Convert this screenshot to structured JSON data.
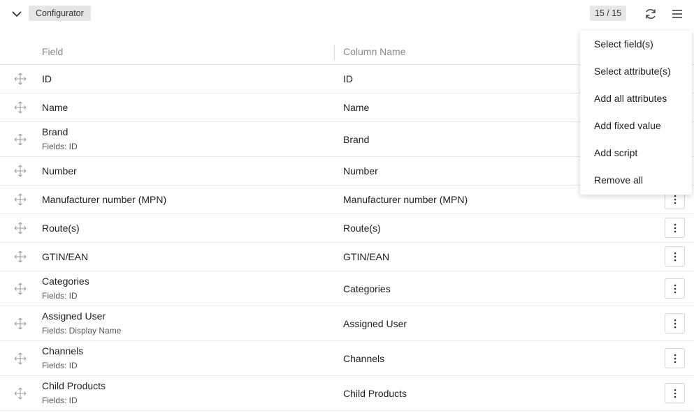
{
  "toolbar": {
    "configurator_label": "Configurator",
    "counter": "15 / 15"
  },
  "table": {
    "headers": {
      "field": "Field",
      "column_name": "Column Name"
    },
    "rows": [
      {
        "field": "ID",
        "sub": "",
        "column": "ID"
      },
      {
        "field": "Name",
        "sub": "",
        "column": "Name"
      },
      {
        "field": "Brand",
        "sub": "Fields: ID",
        "column": "Brand"
      },
      {
        "field": "Number",
        "sub": "",
        "column": "Number"
      },
      {
        "field": "Manufacturer number (MPN)",
        "sub": "",
        "column": "Manufacturer number (MPN)"
      },
      {
        "field": "Route(s)",
        "sub": "",
        "column": "Route(s)"
      },
      {
        "field": "GTIN/EAN",
        "sub": "",
        "column": "GTIN/EAN"
      },
      {
        "field": "Categories",
        "sub": "Fields: ID",
        "column": "Categories"
      },
      {
        "field": "Assigned User",
        "sub": "Fields: Display Name",
        "column": "Assigned User"
      },
      {
        "field": "Channels",
        "sub": "Fields: ID",
        "column": "Channels"
      },
      {
        "field": "Child Products",
        "sub": "Fields: ID",
        "column": "Child Products"
      }
    ]
  },
  "menu": {
    "items": [
      "Select field(s)",
      "Select attribute(s)",
      "Add all attributes",
      "Add fixed value",
      "Add script",
      "Remove all"
    ]
  },
  "icons": {
    "collapse": "chevron-down-icon",
    "refresh": "refresh-icon",
    "menu": "hamburger-menu-icon",
    "drag": "move-icon",
    "more": "more-vertical-icon"
  }
}
